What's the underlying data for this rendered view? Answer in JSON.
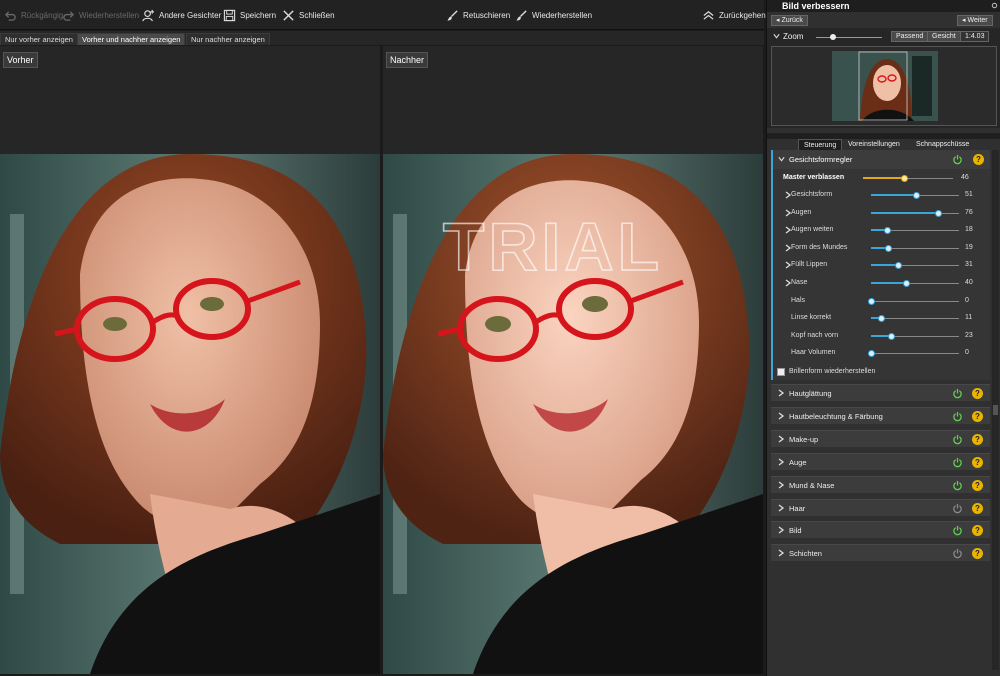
{
  "toolbar": {
    "undo_label": "Rückgängig",
    "redo_label": "Wiederherstellen",
    "other_faces_label": "Andere Gesichter",
    "save_label": "Speichern",
    "close_label": "Schließen",
    "retouch_label": "Retuschieren",
    "restore_label": "Wiederherstellen",
    "back_label": "Zurückgehen"
  },
  "view_tabs": [
    "Nur vorher anzeigen",
    "Vorher und nachher anzeigen",
    "Nur nachher anzeigen"
  ],
  "panes": {
    "before_label": "Vorher",
    "after_label": "Nachher",
    "watermark": "TRIAL"
  },
  "panel": {
    "title": "Bild verbessern",
    "back_btn": "Zurück",
    "next_btn": "Weiter",
    "zoom_label": "Zoom",
    "fit_btn": "Passend",
    "face_btn": "Gesicht",
    "zoom_value": "1:4.03",
    "zoom_level": 0.25,
    "tabs": [
      "Steuerung",
      "Voreinstellungen",
      "Schnappschüsse"
    ],
    "face_shape_title": "Gesichtsformregler",
    "master_label": "Master verblassen",
    "master_value": "46",
    "sliders": [
      {
        "label": "Gesichtsform",
        "value": "51",
        "arrow": true
      },
      {
        "label": "Augen",
        "value": "76",
        "arrow": true
      },
      {
        "label": "Augen weiten",
        "value": "18",
        "arrow": true
      },
      {
        "label": "Form des Mundes",
        "value": "19",
        "arrow": true
      },
      {
        "label": "Füllt Lippen",
        "value": "31",
        "arrow": true
      },
      {
        "label": "Nase",
        "value": "40",
        "arrow": true
      },
      {
        "label": "Hals",
        "value": "0",
        "arrow": false
      },
      {
        "label": "Linse korrekt",
        "value": "11",
        "arrow": false
      },
      {
        "label": "Kopf nach vorn",
        "value": "23",
        "arrow": false
      },
      {
        "label": "Haar Volumen",
        "value": "0",
        "arrow": false
      }
    ],
    "glasses_label": "Brillenform wiederherstellen",
    "sections": [
      {
        "label": "Hautglättung",
        "power_color": "#5fcf4f"
      },
      {
        "label": "Hautbeleuchtung & Färbung",
        "power_color": "#5fcf4f"
      },
      {
        "label": "Make-up",
        "power_color": "#5fcf4f"
      },
      {
        "label": "Auge",
        "power_color": "#5fcf4f"
      },
      {
        "label": "Mund & Nase",
        "power_color": "#5fcf4f"
      },
      {
        "label": "Haar",
        "power_color": "#888888"
      },
      {
        "label": "Bild",
        "power_color": "#5fcf4f"
      },
      {
        "label": "Schichten",
        "power_color": "#888888"
      }
    ],
    "help_glyph": "?"
  },
  "colors": {
    "accent": "#3aa5d8",
    "power_on": "#5fcf4f",
    "help": "#e9b400",
    "glasses": "#d6141c"
  }
}
